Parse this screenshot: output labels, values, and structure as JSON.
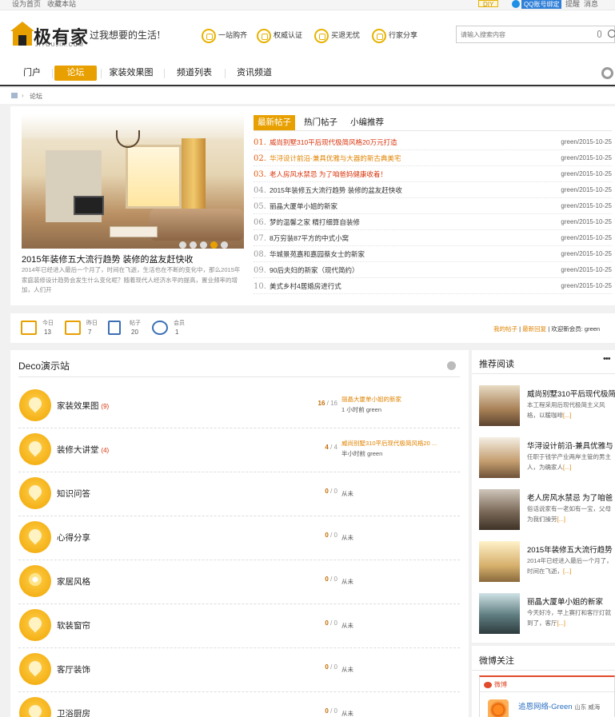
{
  "topbar": {
    "set_home": "设为首页",
    "bookmark": "收藏本站",
    "diy": "DIY",
    "qq_bind": "QQ账号绑定",
    "remind": "提醒",
    "message": "消息"
  },
  "header": {
    "brand": "极有家",
    "brand_sub": "JIYOUJIA.COM",
    "slogan": "过我想要的生活!",
    "features": [
      "一站购齐",
      "权威认证",
      "买退无忧",
      "行家分享"
    ],
    "search_placeholder": "请输入搜索内容"
  },
  "nav": {
    "items": [
      "门户",
      "论坛",
      "家装效果图",
      "频道列表",
      "资讯频道"
    ],
    "active": "论坛"
  },
  "breadcrumb": {
    "current": "论坛"
  },
  "hero": {
    "slide_title": "2015年装修五大流行趋势 装修的盆友赶快收",
    "slide_desc": "2014年已经进入最后一个月了，时间在飞逝，生活也在不断的变化中，那么2015年家庭装修设计趋势会发生什么变化呢？随着现代人经济水平的提高，置业频率的增加，人们开",
    "dots": 5,
    "active_dot": 4,
    "tabs": [
      "最新帖子",
      "热门帖子",
      "小编推荐"
    ],
    "posts": [
      {
        "num": "01.",
        "title": "威尚别墅310平后现代极简风格20万元打造",
        "meta": "green/2015-10-25",
        "style": "red"
      },
      {
        "num": "02.",
        "title": "华浔设计前沿-兼具优雅与大器的新古典美宅",
        "meta": "green/2015-10-25",
        "style": "orange"
      },
      {
        "num": "03.",
        "title": "老人房风水禁忌 为了咱爸妈健康收着！",
        "meta": "green/2015-10-25",
        "style": "red2"
      },
      {
        "num": "04.",
        "title": "2015年装修五大流行趋势 装修的盆友赶快收",
        "meta": "green/2015-10-25",
        "style": ""
      },
      {
        "num": "05.",
        "title": "丽晶大厦单小姐的新家",
        "meta": "green/2015-10-25",
        "style": ""
      },
      {
        "num": "06.",
        "title": "梦的温馨之家 精打细算自装修",
        "meta": "green/2015-10-25",
        "style": ""
      },
      {
        "num": "07.",
        "title": "8万穷装87平方的中式小窝",
        "meta": "green/2015-10-25",
        "style": ""
      },
      {
        "num": "08.",
        "title": "华城景苑嘉和嘉园蔡女士的新家",
        "meta": "green/2015-10-25",
        "style": ""
      },
      {
        "num": "09.",
        "title": "90后夫妇的新家（现代简约）",
        "meta": "green/2015-10-25",
        "style": ""
      },
      {
        "num": "10.",
        "title": "美式乡村4居婚房进行式",
        "meta": "green/2015-10-25",
        "style": ""
      }
    ]
  },
  "stats": {
    "items": [
      {
        "label": "今日",
        "value": "13"
      },
      {
        "label": "昨日",
        "value": "7"
      },
      {
        "label": "帖子",
        "value": "20"
      },
      {
        "label": "会员",
        "value": "1"
      }
    ],
    "my_posts": "我的帖子",
    "latest_reply": "最新回复",
    "welcome": "欢迎新会员: green"
  },
  "forum": {
    "title": "Deco演示站",
    "boards": [
      {
        "name": "家装效果图",
        "count": "(9)",
        "threads": "16",
        "posts": "16",
        "last_title": "丽晶大厦单小姐的新家",
        "last_meta": "1 小时前 green",
        "icon": "drop"
      },
      {
        "name": "装修大讲堂",
        "count": "(4)",
        "threads": "4",
        "posts": "4",
        "last_title": "威尚别墅310平后现代极简风格20 ...",
        "last_meta": "半小时前 green",
        "icon": "drop"
      },
      {
        "name": "知识问答",
        "count": "",
        "threads": "0",
        "posts": "0",
        "last_title": "",
        "last_meta": "从未",
        "icon": "drop"
      },
      {
        "name": "心得分享",
        "count": "",
        "threads": "0",
        "posts": "0",
        "last_title": "",
        "last_meta": "从未",
        "icon": "drop"
      },
      {
        "name": "家居风格",
        "count": "",
        "threads": "0",
        "posts": "0",
        "last_title": "",
        "last_meta": "从未",
        "icon": "flower"
      },
      {
        "name": "软装窗帘",
        "count": "",
        "threads": "0",
        "posts": "0",
        "last_title": "",
        "last_meta": "从未",
        "icon": "drop"
      },
      {
        "name": "客厅装饰",
        "count": "",
        "threads": "0",
        "posts": "0",
        "last_title": "",
        "last_meta": "从未",
        "icon": "drop"
      },
      {
        "name": "卫浴厨房",
        "count": "",
        "threads": "0",
        "posts": "0",
        "last_title": "",
        "last_meta": "从未",
        "icon": "drop"
      }
    ]
  },
  "sidebar": {
    "title": "推荐阅读",
    "more": "•••",
    "items": [
      {
        "title": "威尚别墅310平后现代极简",
        "desc": "本工程采用后现代极简主义风格，以暖咖啡",
        "more": "[...]"
      },
      {
        "title": "华浔设计前沿-兼具优雅与",
        "desc": "任职于钱学产业两岸主管的男主人，为确家人",
        "more": "[...]"
      },
      {
        "title": "老人房风水禁忌 为了咱爸",
        "desc": "俗话说家有一老如有一宝，父母为我们操劳",
        "more": "[...]"
      },
      {
        "title": "2015年装修五大流行趋势",
        "desc": "2014年已经进入最后一个月了，时间在飞逝，",
        "more": "[...]"
      },
      {
        "title": "丽晶大厦单小姐的新家",
        "desc": "今天好冷，早上赛打和客厅灯就到了，客厅",
        "more": "[...]"
      }
    ]
  },
  "weibo": {
    "title": "微博关注",
    "brand": "微博",
    "account": "追恩网络-Green",
    "location": "山东 威海"
  }
}
